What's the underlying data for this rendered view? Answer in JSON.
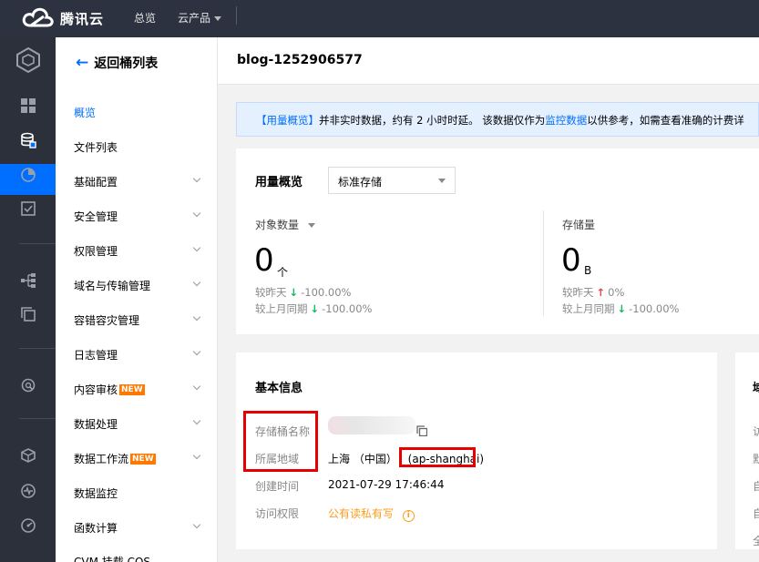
{
  "topbar": {
    "brand": "腾讯云",
    "nav": [
      {
        "label": "总览"
      },
      {
        "label": "云产品"
      }
    ]
  },
  "rail": {
    "icons": [
      "cube-icon",
      "grid-icon",
      "bucket-icon",
      "pie-chart-icon",
      "checklist-icon",
      "tree-icon",
      "copy-icon",
      "search-icon",
      "hexagon-icon",
      "pulse-icon",
      "gauge-icon"
    ]
  },
  "sidebar": {
    "back_label": "返回桶列表",
    "items": [
      {
        "label": "概览",
        "active": true,
        "expandable": false
      },
      {
        "label": "文件列表",
        "expandable": false
      },
      {
        "label": "基础配置",
        "expandable": true
      },
      {
        "label": "安全管理",
        "expandable": true
      },
      {
        "label": "权限管理",
        "expandable": true
      },
      {
        "label": "域名与传输管理",
        "expandable": true
      },
      {
        "label": "容错容灾管理",
        "expandable": true
      },
      {
        "label": "日志管理",
        "expandable": true
      },
      {
        "label": "内容审核",
        "badge": "NEW",
        "expandable": true
      },
      {
        "label": "数据处理",
        "expandable": true
      },
      {
        "label": "数据工作流",
        "badge": "NEW",
        "expandable": true
      },
      {
        "label": "数据监控",
        "expandable": false
      },
      {
        "label": "函数计算",
        "expandable": true
      },
      {
        "label": "CVM 挂载 COS",
        "expandable": false
      }
    ]
  },
  "main": {
    "title": "blog-1252906577",
    "notice": {
      "tag": "【用量概览】",
      "text": "并非实时数据，约有 2 小时时延。 该数据仅作为监控数据以供参考，如需查看准确的计费详",
      "link": "监控数据"
    },
    "usage": {
      "title": "用量概览",
      "select_value": "标准存储",
      "metrics": [
        {
          "label": "对象数量",
          "value": "0",
          "unit": "个",
          "day_label": "较昨天",
          "day_dir": "down",
          "day_value": "-100.00%",
          "month_label": "较上月同期",
          "month_dir": "down",
          "month_value": "-100.00%"
        },
        {
          "label": "存储量",
          "value": "0",
          "unit": "B",
          "day_label": "较昨天",
          "day_dir": "up",
          "day_value": "0%",
          "month_label": "较上月同期",
          "month_dir": "down",
          "month_value": "-100.00%"
        }
      ]
    },
    "basic_info": {
      "title": "基本信息",
      "rows": [
        {
          "label": "存储桶名称",
          "value": ""
        },
        {
          "label": "所属地域",
          "value": "上海 （中国）",
          "region_code": "(ap-shanghai)"
        },
        {
          "label": "创建时间",
          "value": "2021-07-29 17:46:44"
        },
        {
          "label": "访问权限",
          "value": "公有读私有写"
        }
      ]
    },
    "right_card_fragments": [
      "域",
      "访",
      "默",
      "自",
      "自",
      "全"
    ]
  },
  "colors": {
    "topbar": "#2c323f",
    "rail": "#2b303b",
    "accent": "#006eff",
    "badge": "#ff7800",
    "down": "#0abf5b",
    "up": "#e54545",
    "highlight_box": "#e60000",
    "permission": "#ff9c19"
  }
}
